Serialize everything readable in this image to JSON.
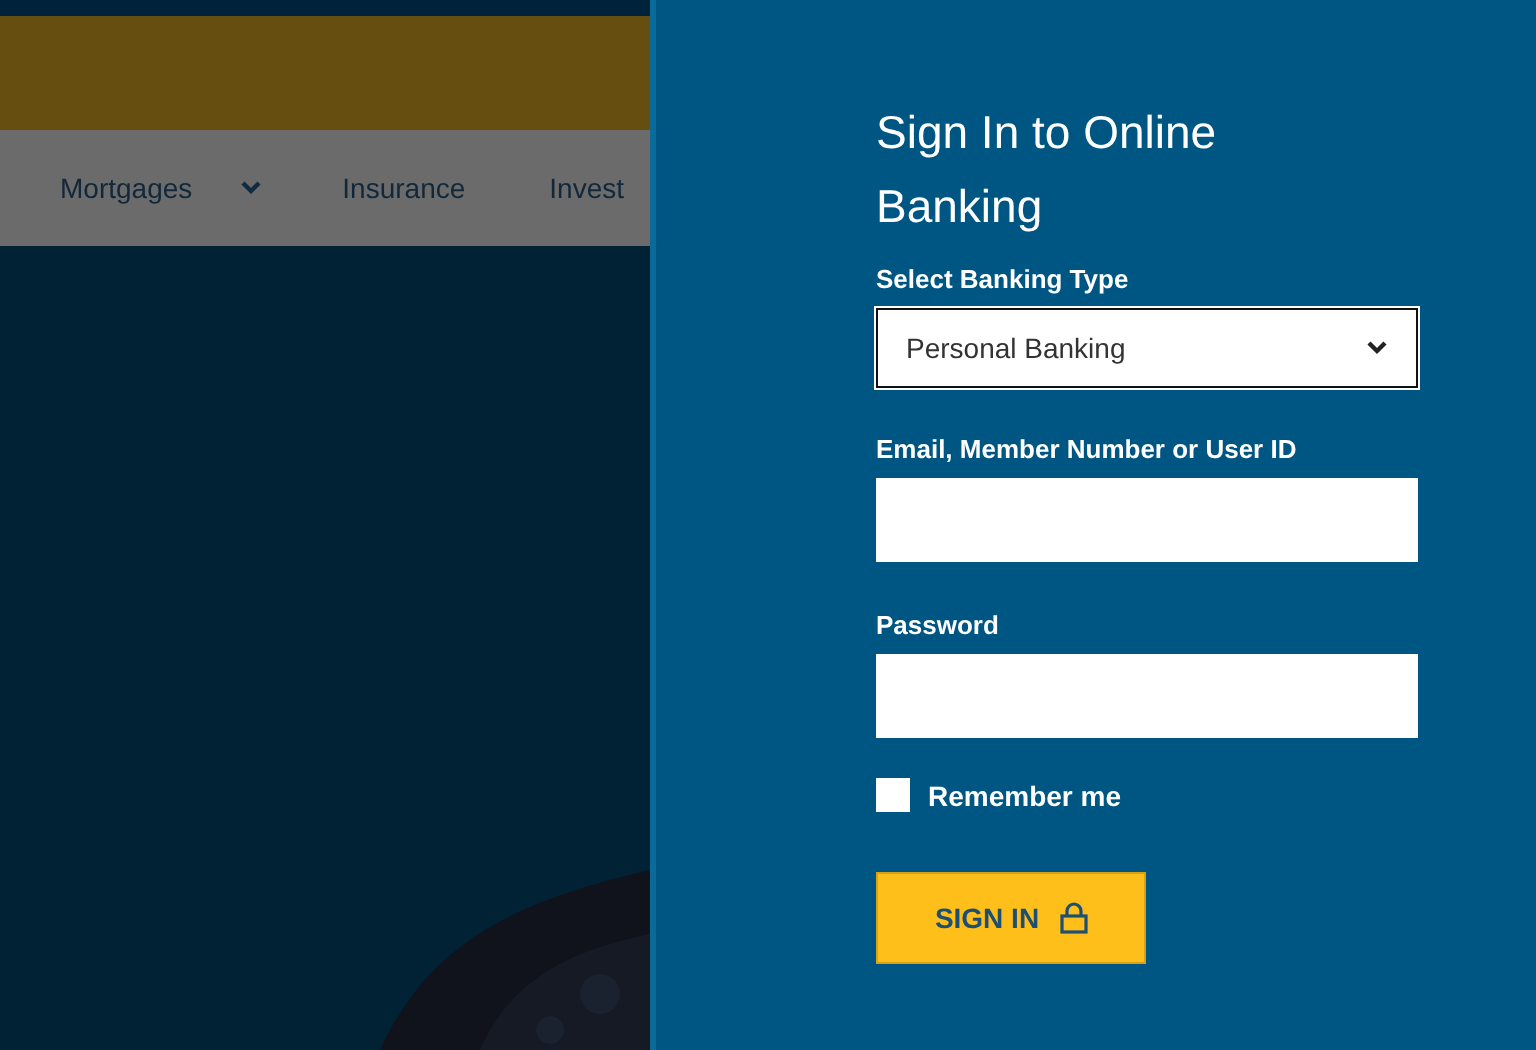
{
  "nav": {
    "items": [
      {
        "label": "Mortgages",
        "has_menu": true
      },
      {
        "label": "Insurance",
        "has_menu": false
      },
      {
        "label": "Invest",
        "has_menu": false
      }
    ]
  },
  "signin": {
    "title": "Sign In to Online Banking",
    "banking_type": {
      "label": "Select Banking Type",
      "value": "Personal Banking"
    },
    "user": {
      "label": "Email, Member Number or User ID"
    },
    "password": {
      "label": "Password"
    },
    "remember": {
      "label": "Remember me",
      "checked": false
    },
    "button": "SIGN IN"
  }
}
